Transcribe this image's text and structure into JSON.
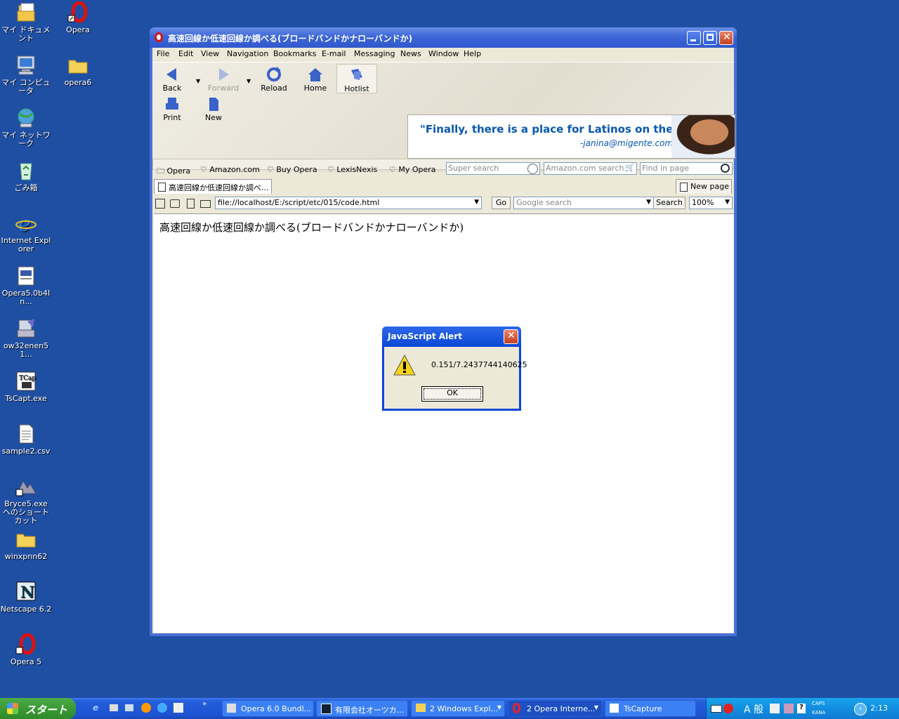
{
  "desktop": {
    "icons": [
      {
        "label": "マイ ドキュメント"
      },
      {
        "label": "Opera"
      },
      {
        "label": "マイ コンピュータ"
      },
      {
        "label": "opera6"
      },
      {
        "label": "マイ ネットワーク"
      },
      {
        "label": "ごみ箱"
      },
      {
        "label": "Internet Explorer"
      },
      {
        "label": "Opera5.0b4In..."
      },
      {
        "label": "ow32enen51..."
      },
      {
        "label": "TsCapt.exe"
      },
      {
        "label": "sample2.csv"
      },
      {
        "label": "Bryce5.exe へのショートカット"
      },
      {
        "label": "winxpnn62"
      },
      {
        "label": "Netscape 6.2"
      },
      {
        "label": "Opera 5"
      }
    ]
  },
  "browser": {
    "title": "高速回線か低速回線か調べる(ブロードバンドかナローバンドか)",
    "menu": [
      "File",
      "Edit",
      "View",
      "Navigation",
      "Bookmarks",
      "E-mail",
      "Messaging",
      "News",
      "Window",
      "Help"
    ],
    "toolbar": {
      "back": "Back",
      "forward": "Forward",
      "reload": "Reload",
      "home": "Home",
      "hotlist": "Hotlist",
      "print": "Print",
      "new": "New"
    },
    "ad": {
      "line1": "\"Finally, there is a place for Latinos on the web.\"",
      "line2": "-janina@migente.com"
    },
    "bookmarks": [
      "Opera",
      "Amazon.com",
      "Buy Opera",
      "LexisNexis",
      "My Opera"
    ],
    "search_boxes": {
      "super_search": "Super search",
      "amazon_search": "Amazon.com search",
      "find_in_page": "Find in page"
    },
    "tabs": {
      "active": "高速回線か低速回線か調べ...",
      "new_page": "New page"
    },
    "address": {
      "url": "file://localhost/E:/script/etc/015/code.html",
      "go": "Go",
      "google_placeholder": "Google search",
      "search_button": "Search",
      "zoom": "100%"
    },
    "page_text": "高速回線か低速回線か調べる(ブロードバンドかナローバンドか)"
  },
  "alert": {
    "title": "JavaScript Alert",
    "message": "0.151/7.2437744140625",
    "ok": "OK"
  },
  "taskbar": {
    "start": "スタート",
    "tasks": [
      "Opera 6.0 Bundl...",
      "有限会社オーツカ...",
      "2 Windows Expl...",
      "2 Opera Interne...",
      "TsCapture"
    ],
    "tray": {
      "ime": "A 般",
      "caps": "CAPS",
      "kana": "KANA"
    },
    "clock": "2:13"
  },
  "colors": {
    "desktop": "#1f4fa3",
    "titlebar": "#3d66d9",
    "ad_text": "#0a57b5"
  }
}
